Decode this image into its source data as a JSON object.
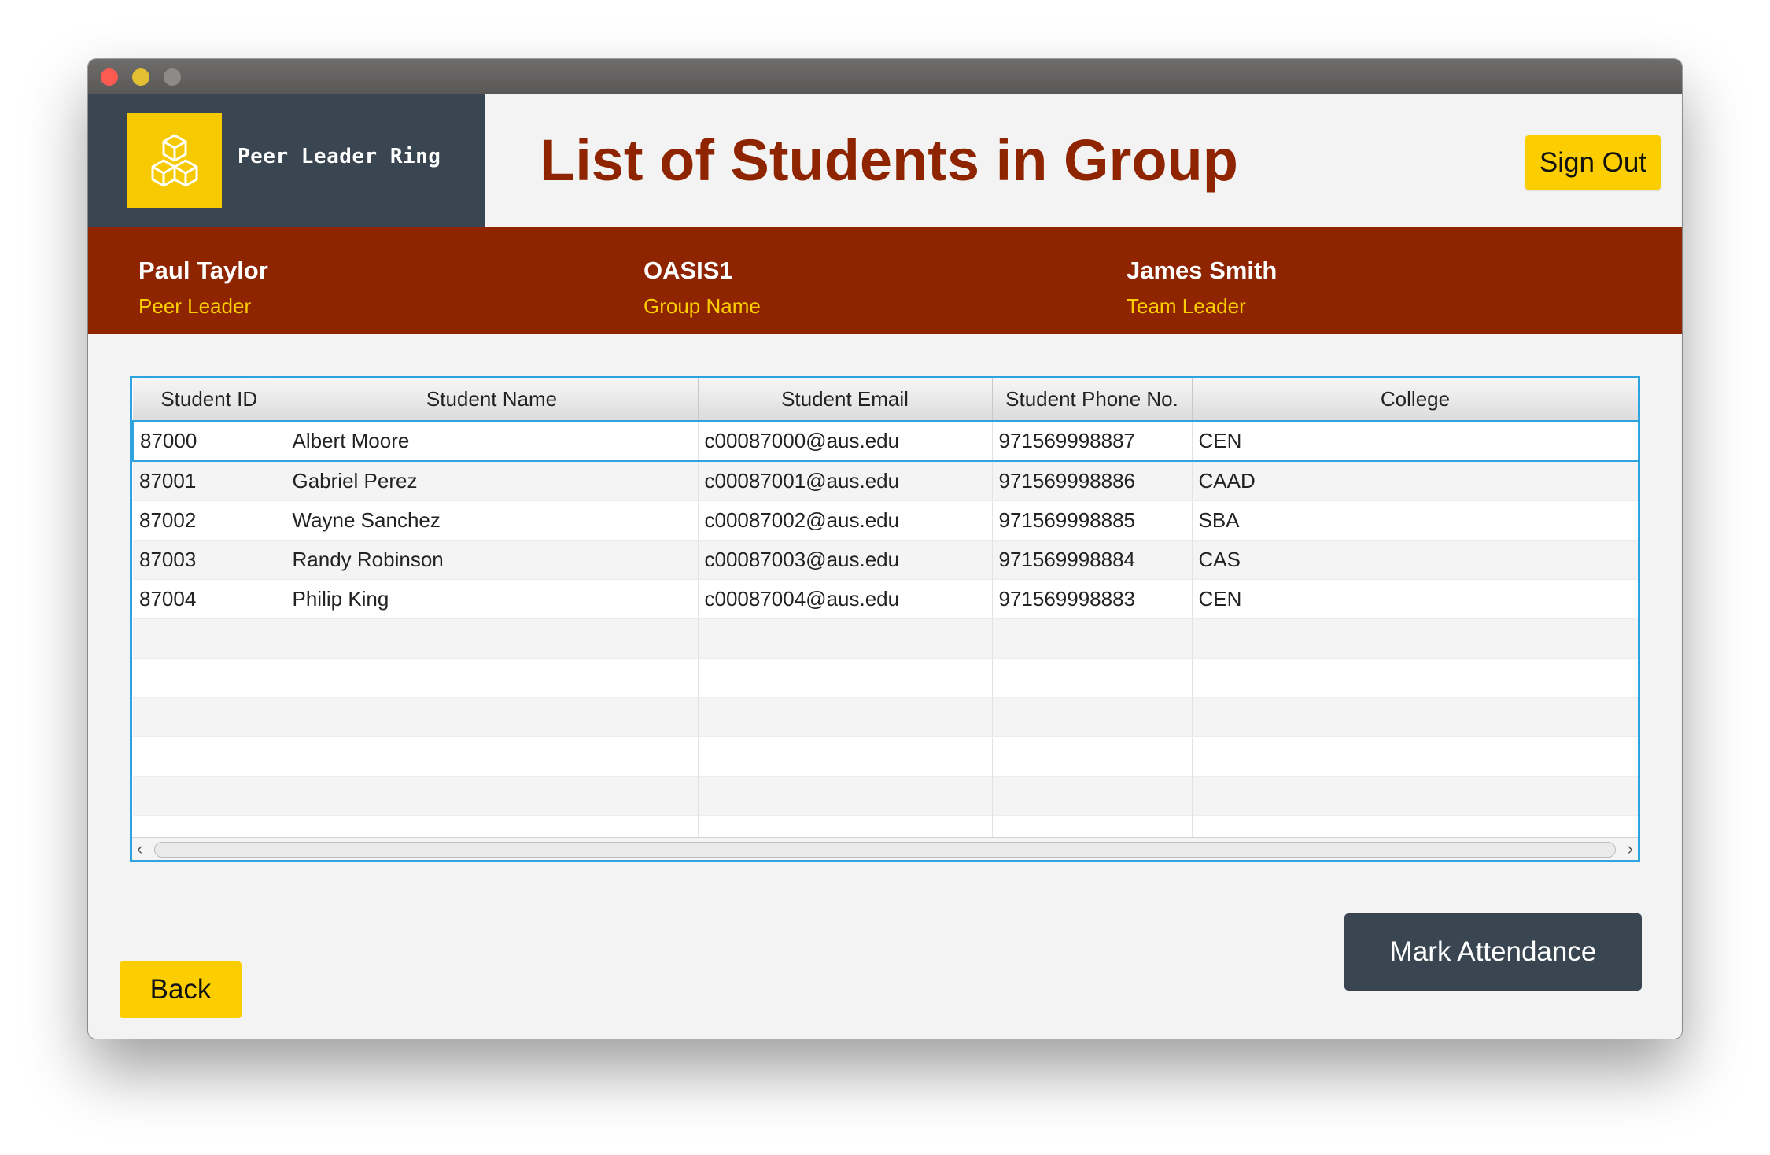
{
  "app": {
    "name": "Peer Leader Ring"
  },
  "header": {
    "title": "List of Students in Group",
    "signout_label": "Sign Out"
  },
  "info": {
    "peer_leader": {
      "name": "Paul Taylor",
      "role": "Peer Leader"
    },
    "group": {
      "name": "OASIS1",
      "role": "Group Name"
    },
    "team_leader": {
      "name": "James Smith",
      "role": "Team Leader"
    }
  },
  "table": {
    "columns": [
      "Student ID",
      "Student Name",
      "Student Email",
      "Student Phone No.",
      "College"
    ],
    "rows": [
      [
        "87000",
        "Albert Moore",
        "c00087000@aus.edu",
        "971569998887",
        "CEN"
      ],
      [
        "87001",
        "Gabriel Perez",
        "c00087001@aus.edu",
        "971569998886",
        "CAAD"
      ],
      [
        "87002",
        "Wayne Sanchez",
        "c00087002@aus.edu",
        "971569998885",
        "SBA"
      ],
      [
        "87003",
        "Randy Robinson",
        "c00087003@aus.edu",
        "971569998884",
        "CAS"
      ],
      [
        "87004",
        "Philip King",
        "c00087004@aus.edu",
        "971569998883",
        "CEN"
      ]
    ],
    "selected_row": 0,
    "empty_rows": 6
  },
  "buttons": {
    "back_label": "Back",
    "mark_attendance_label": "Mark Attendance"
  },
  "colors": {
    "accent_yellow": "#fcce00",
    "dark_slate": "#394550",
    "maroon": "#8e2400",
    "selection_blue": "#2ea3dd"
  }
}
